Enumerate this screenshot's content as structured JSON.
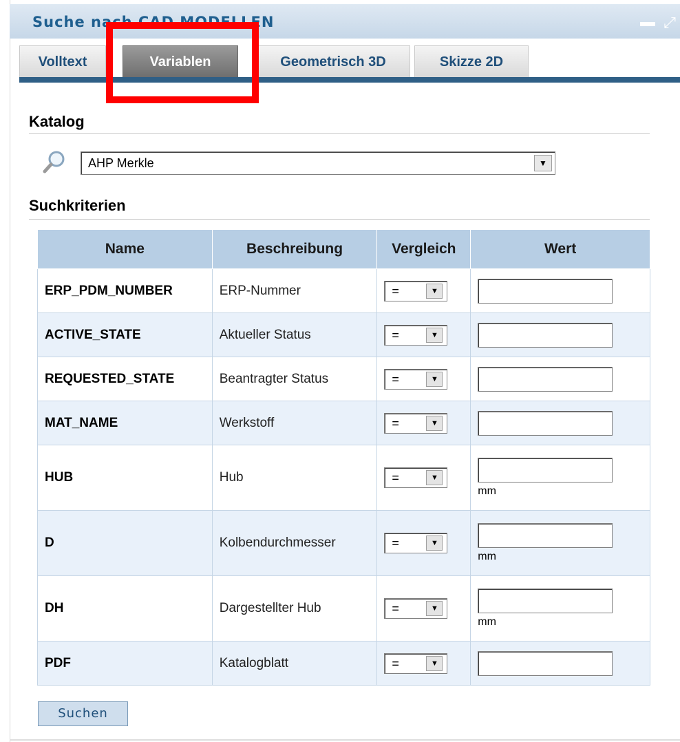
{
  "header": {
    "title": "Suche nach CAD MODELLEN"
  },
  "tabs": [
    {
      "label": "Volltext"
    },
    {
      "label": "Variablen",
      "active": true
    },
    {
      "label": "Geometrisch 3D"
    },
    {
      "label": "Skizze 2D"
    }
  ],
  "catalog": {
    "heading": "Katalog",
    "selected": "AHP Merkle"
  },
  "criteria": {
    "heading": "Suchkriterien",
    "columns": [
      "Name",
      "Beschreibung",
      "Vergleich",
      "Wert"
    ],
    "rows": [
      {
        "name": "ERP_PDM_NUMBER",
        "desc": "ERP-Nummer",
        "cmp": "=",
        "value": "",
        "unit": ""
      },
      {
        "name": "ACTIVE_STATE",
        "desc": "Aktueller Status",
        "cmp": "=",
        "value": "",
        "unit": ""
      },
      {
        "name": "REQUESTED_STATE",
        "desc": "Beantragter Status",
        "cmp": "=",
        "value": "",
        "unit": ""
      },
      {
        "name": "MAT_NAME",
        "desc": "Werkstoff",
        "cmp": "=",
        "value": "",
        "unit": ""
      },
      {
        "name": "HUB",
        "desc": "Hub",
        "cmp": "=",
        "value": "",
        "unit": "mm"
      },
      {
        "name": "D",
        "desc": "Kolbendurchmesser",
        "cmp": "=",
        "value": "",
        "unit": "mm"
      },
      {
        "name": "DH",
        "desc": "Dargestellter Hub",
        "cmp": "=",
        "value": "",
        "unit": "mm"
      },
      {
        "name": "PDF",
        "desc": "Katalogblatt",
        "cmp": "=",
        "value": "",
        "unit": ""
      }
    ]
  },
  "actions": {
    "search_label": "Suchen"
  },
  "highlight_color": "#ff0000",
  "accent_color": "#2f5f86"
}
